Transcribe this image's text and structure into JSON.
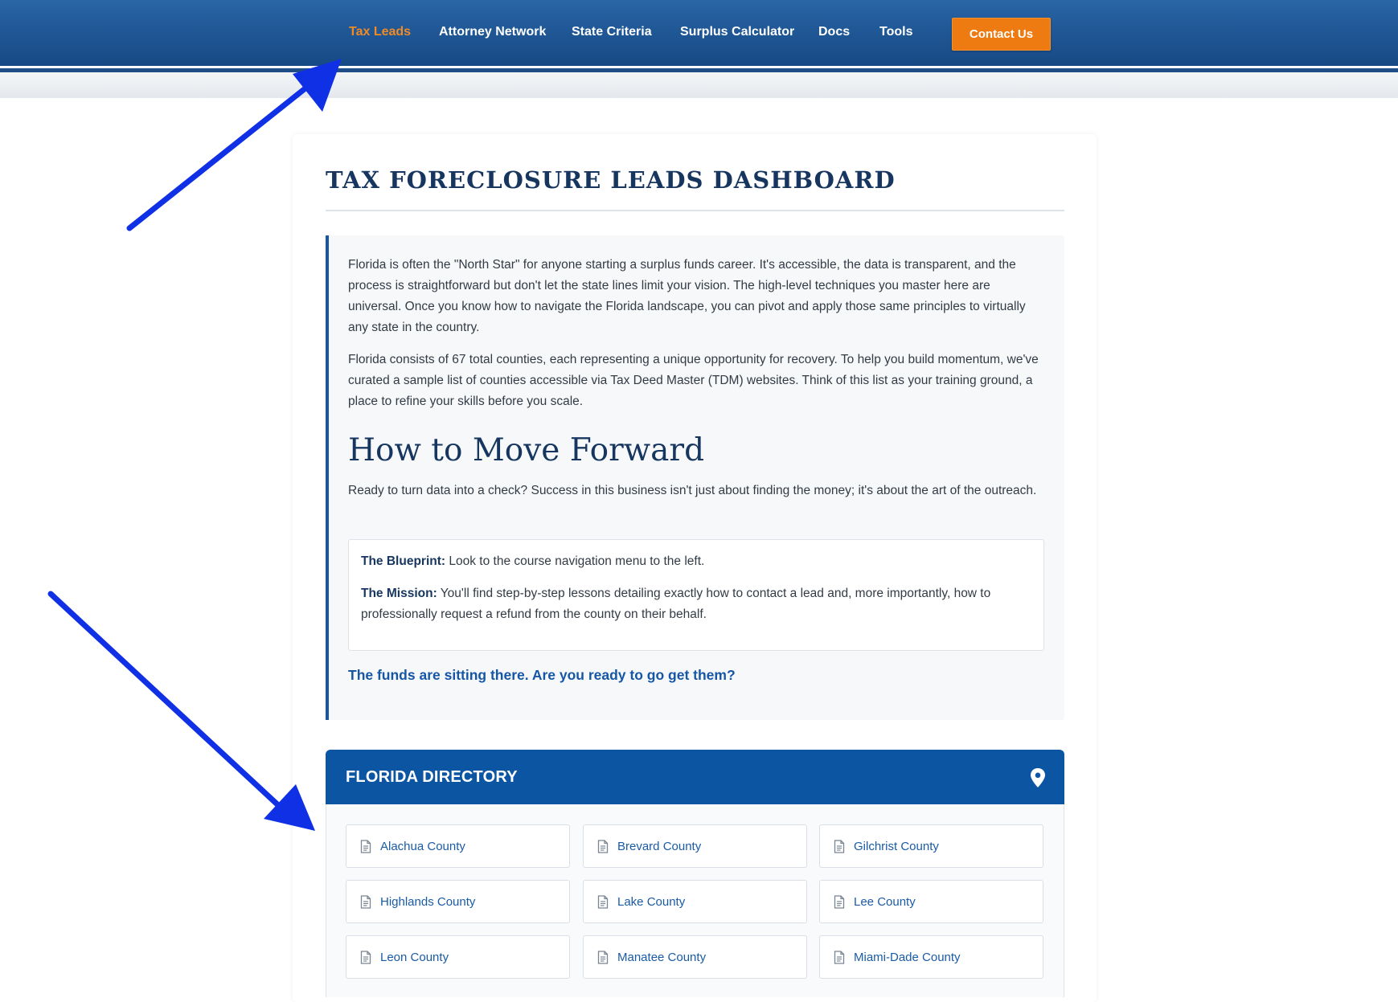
{
  "nav": {
    "items": [
      {
        "label": "Tax Leads",
        "active": true
      },
      {
        "label": "Attorney Network",
        "active": false
      },
      {
        "label": "State Criteria",
        "active": false
      },
      {
        "label": "Surplus Calculator",
        "active": false
      },
      {
        "label": "Docs",
        "active": false
      },
      {
        "label": "Tools",
        "active": false
      }
    ],
    "contact_label": "Contact Us"
  },
  "dashboard": {
    "title": "TAX FORECLOSURE LEADS DASHBOARD",
    "intro_p1": "Florida is often the \"North Star\" for anyone starting a surplus funds career. It's accessible, the data is transparent, and the process is straightforward but don't let the state lines limit your vision. The high-level techniques you master here are universal. Once you know how to navigate the Florida landscape, you can pivot and apply those same principles to virtually any state in the country.",
    "intro_p2": "Florida consists of 67 total counties, each representing a unique opportunity for recovery. To help you build momentum, we've curated a sample list of counties accessible via Tax Deed Master (TDM) websites. Think of this list as your training ground, a place to refine your skills before you scale.",
    "how_title": "How to Move Forward",
    "how_text": "Ready to turn data into a check? Success in this business isn't just about finding the money; it's about the art of the outreach.",
    "blueprint_label": "The Blueprint:",
    "blueprint_text": " Look to the course navigation menu to the left.",
    "mission_label": "The Mission:",
    "mission_text": " You'll find step-by-step lessons detailing exactly how to contact a lead and, more importantly, how to professionally request a refund from the county on their behalf.",
    "cta": "The funds are sitting there. Are you ready to go get them?"
  },
  "directory": {
    "title": "FLORIDA DIRECTORY",
    "counties": [
      "Alachua County",
      "Brevard County",
      "Gilchrist County",
      "Highlands County",
      "Lake County",
      "Lee County",
      "Leon County",
      "Manatee County",
      "Miami-Dade County"
    ]
  },
  "colors": {
    "nav_bg": "#1e5593",
    "nav_active": "#f08a25",
    "contact_bg": "#ee7a12",
    "heading": "#17365f",
    "accent": "#1656a4",
    "directory_header": "#0b55a3",
    "annotation_arrow": "#1030e6"
  },
  "icons": {
    "directory": "map-pin-icon",
    "county": "document-icon"
  }
}
